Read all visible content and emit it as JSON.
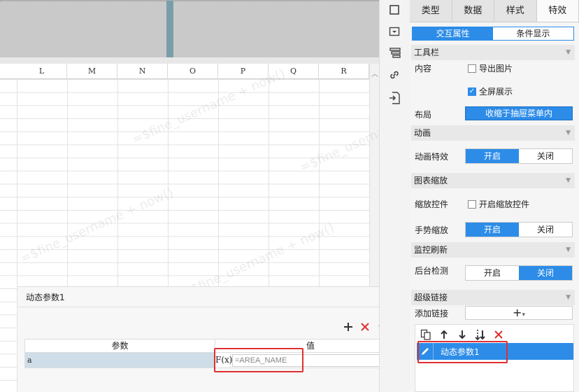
{
  "sheet": {
    "columns": [
      "L",
      "M",
      "N",
      "O",
      "P",
      "Q",
      "R"
    ],
    "watermark": "=$fine_username + now()"
  },
  "param_panel": {
    "title": "动态参数1",
    "columns": [
      "参数",
      "值"
    ],
    "row": {
      "key": "a",
      "value": "=AREA_NAME",
      "fx": "F(x)"
    }
  },
  "right_panel": {
    "tabs": [
      "类型",
      "数据",
      "样式",
      "特效"
    ],
    "active_tab": "特效",
    "subtabs": [
      "交互属性",
      "条件显示"
    ],
    "active_subtab": "交互属性",
    "toolbar": {
      "title": "工具栏",
      "content_label": "内容",
      "export_image": "导出图片",
      "export_image_checked": false,
      "fullscreen": "全屏展示",
      "fullscreen_checked": true,
      "layout_label": "布局",
      "layout_value": "收缩于抽屉菜单内"
    },
    "animation": {
      "title": "动画",
      "effect_label": "动画特效",
      "on": "开启",
      "off": "关闭",
      "selected": "开启"
    },
    "zoom": {
      "title": "图表缩放",
      "control_label": "缩放控件",
      "enable_control": "开启缩放控件",
      "enable_control_checked": false,
      "gesture_label": "手势缩放",
      "on": "开启",
      "off": "关闭",
      "selected": "开启"
    },
    "monitor": {
      "title": "监控刷新",
      "bg_check_label": "后台检测",
      "on": "开启",
      "off": "关闭",
      "selected": "关闭"
    },
    "hyperlink": {
      "title": "超级链接",
      "add_label": "添加链接",
      "add_symbol": "+",
      "items": [
        "动态参数1"
      ]
    }
  },
  "colors": {
    "accent": "#2c8ce8",
    "highlight": "#e03030",
    "row_selected": "#cfdde9"
  }
}
